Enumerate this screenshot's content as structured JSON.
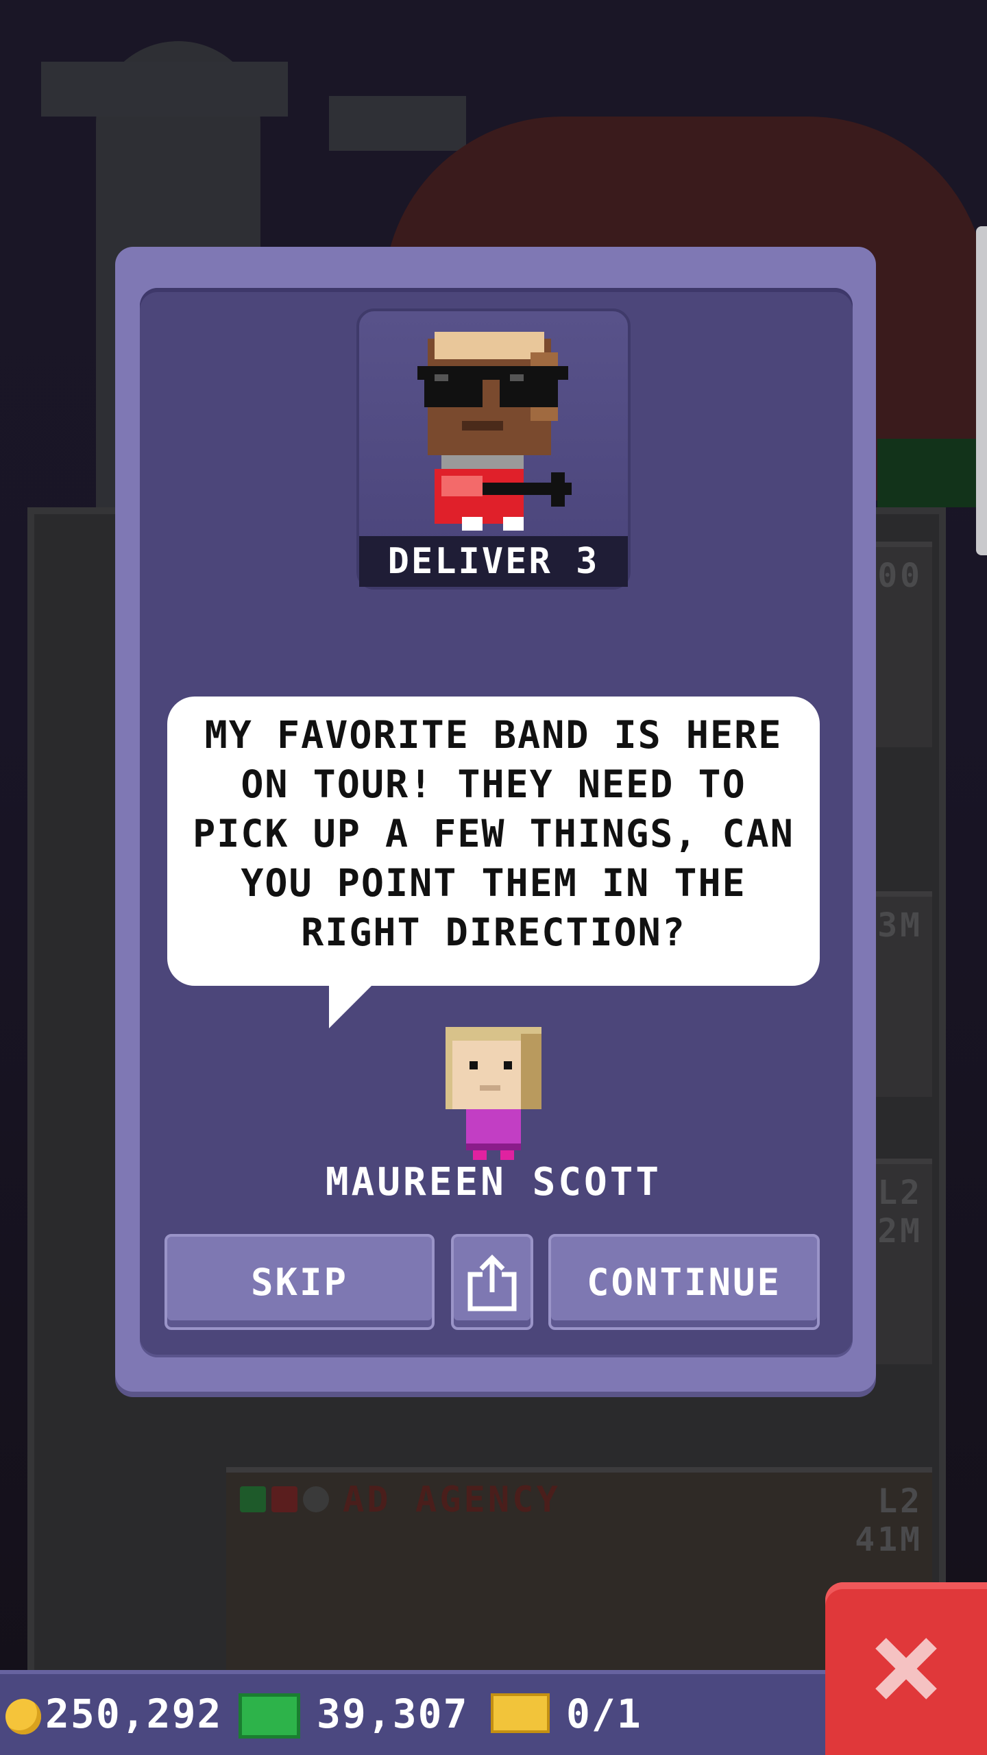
{
  "mission": {
    "deliver_label": "DELIVER 3",
    "speech": "MY FAVORITE BAND IS HERE ON TOUR! THEY NEED TO PICK UP A FEW THINGS, CAN YOU POINT THEM IN THE RIGHT DIRECTION?",
    "npc_name": "MAUREEN SCOTT"
  },
  "buttons": {
    "skip": "SKIP",
    "share_icon": "share-icon",
    "continue": "CONTINUE"
  },
  "background": {
    "floor_tags": [
      "00",
      "3M",
      "L2",
      "2M"
    ],
    "agency_name": "AD AGENCY",
    "agency_level": "L2",
    "agency_value": "41M"
  },
  "hud": {
    "coins": "250,292",
    "bux": "39,307",
    "tickets": "0/1",
    "coin_icon": "coin-icon",
    "bux_icon": "tower-bux-icon",
    "ticket_icon": "vip-ticket-icon"
  },
  "colors": {
    "dialog_outer": "#7f78b4",
    "dialog_inner": "#4c467a",
    "close_button": "#e0383a",
    "hud_bar": "#4b4880"
  }
}
